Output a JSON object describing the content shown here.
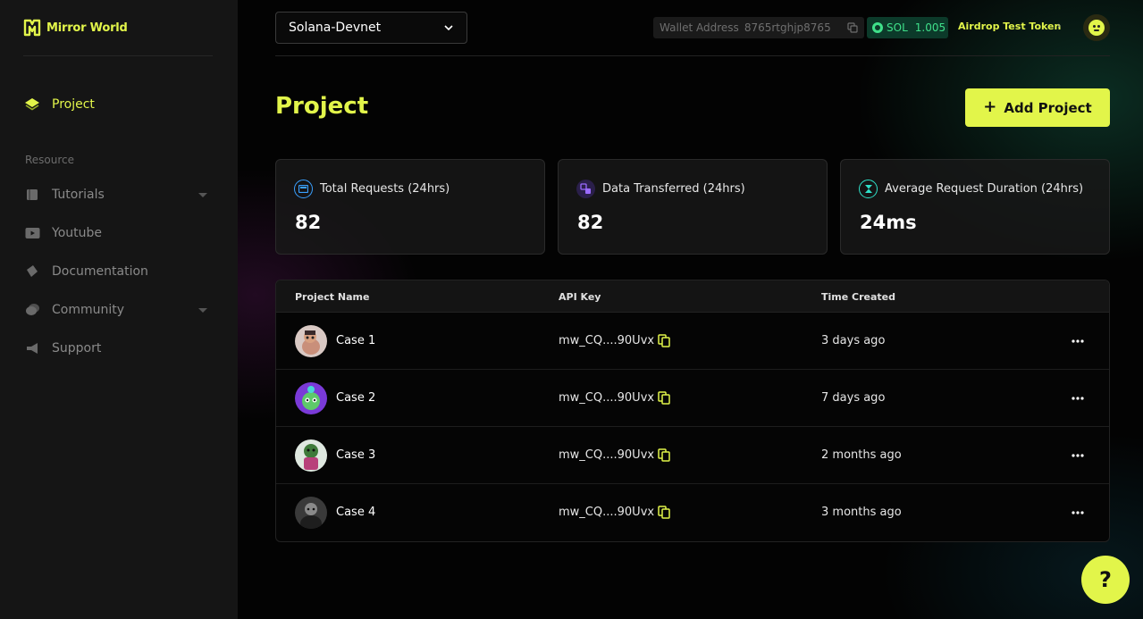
{
  "brand": {
    "name": "Mirror World",
    "accent": "#e2f54a"
  },
  "sidebar": {
    "items": [
      {
        "label": "Project",
        "icon": "layers-icon",
        "active": true
      }
    ],
    "section_label": "Resource",
    "resources": [
      {
        "label": "Tutorials",
        "icon": "book-icon",
        "has_caret": true
      },
      {
        "label": "Youtube",
        "icon": "youtube-icon",
        "has_caret": false
      },
      {
        "label": "Documentation",
        "icon": "document-icon",
        "has_caret": false
      },
      {
        "label": "Community",
        "icon": "chat-icon",
        "has_caret": true
      },
      {
        "label": "Support",
        "icon": "megaphone-icon",
        "has_caret": false
      }
    ]
  },
  "header": {
    "network": "Solana-Devnet",
    "wallet_label": "Wallet Address",
    "wallet_address": "8765rtghjp8765",
    "sol_symbol": "SOL",
    "sol_balance": "1.005",
    "airdrop_label": "Airdrop Test Token",
    "airdrop_arrow": "›"
  },
  "page": {
    "title": "Project",
    "add_button": "Add Project",
    "add_button_icon": "+"
  },
  "stats": [
    {
      "label": "Total Requests (24hrs)",
      "value": "82",
      "icon": "monitor-icon",
      "color": "#3aa0ff"
    },
    {
      "label": "Data Transferred (24hrs)",
      "value": "82",
      "icon": "transfer-icon",
      "color": "#9b6bff"
    },
    {
      "label": "Average Request Duration (24hrs)",
      "value": "24ms",
      "icon": "hourglass-icon",
      "color": "#2fe0c8"
    }
  ],
  "table": {
    "headers": {
      "name": "Project Name",
      "key": "API Key",
      "time": "Time Created"
    },
    "rows": [
      {
        "name": "Case 1",
        "api_key": "mw_CQ....90Uvx",
        "time": "3 days ago"
      },
      {
        "name": "Case 2",
        "api_key": "mw_CQ....90Uvx",
        "time": "7 days ago"
      },
      {
        "name": "Case 3",
        "api_key": "mw_CQ....90Uvx",
        "time": "2 months ago"
      },
      {
        "name": "Case 4",
        "api_key": "mw_CQ....90Uvx",
        "time": "3 months ago"
      }
    ]
  },
  "help": {
    "label": "?"
  }
}
